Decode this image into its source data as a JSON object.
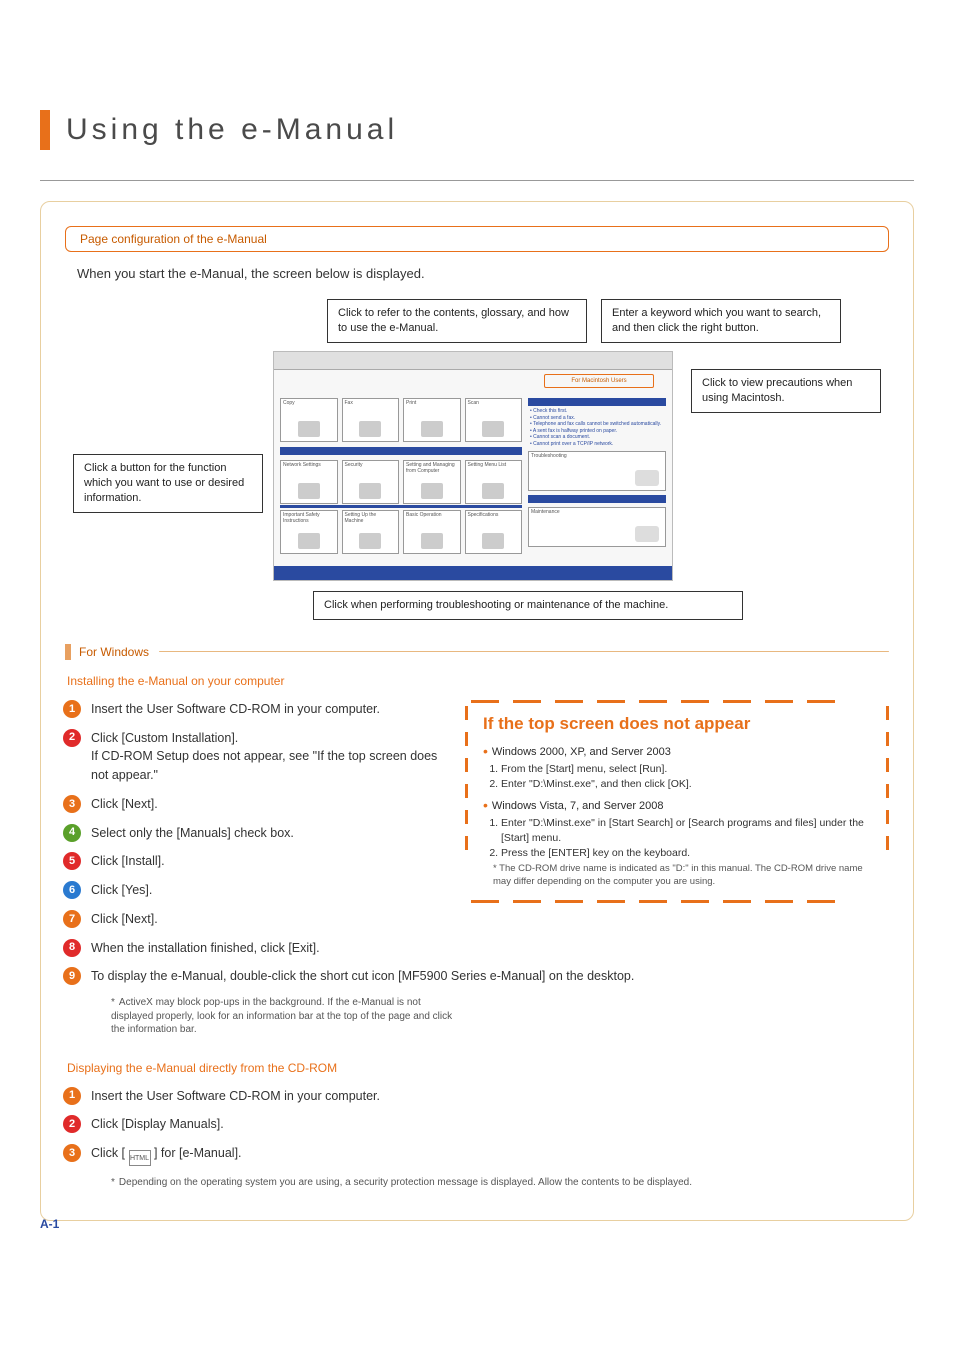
{
  "title": "Using the e-Manual",
  "section1_header": "Page configuration of the e-Manual",
  "intro": "When you start the e-Manual, the screen below is displayed.",
  "callouts": {
    "contents": "Click to refer to the contents, glossary, and how to use the e-Manual.",
    "search": "Enter a keyword which you want to search, and then click the right button.",
    "function": "Click a button for the function which you want to use or desired information.",
    "mac": "Click to view precautions when using Macintosh.",
    "maintenance": "Click when performing troubleshooting or maintenance of the machine."
  },
  "screenshot": {
    "mac_band": "For Macintosh Users",
    "cards_row1": [
      "Copy",
      "Fax",
      "Print",
      "Scan"
    ],
    "cards_row2": [
      "Network Settings",
      "Security",
      "Setting and Managing from Computer",
      "Setting Menu List"
    ],
    "cards_row3": [
      "Important Safety Instructions",
      "Setting Up the Machine",
      "Basic Operation",
      "Specifications"
    ],
    "right_list": [
      "Check this first.",
      "Cannot send a fax.",
      "Telephone and fax calls cannot be switched automatically.",
      "A sent fax is halfway printed on paper.",
      "Cannot scan a document.",
      "Cannot print over a TCP/IP network."
    ],
    "right_box1": "Troubleshooting",
    "right_box2": "Maintenance"
  },
  "for_windows": "For Windows",
  "install_heading": "Installing the e-Manual on your computer",
  "steps_install": [
    "Insert the User Software CD-ROM in your computer.",
    "Click [Custom Installation].",
    "Click [Next].",
    "Select only the [Manuals] check box.",
    "Click [Install].",
    "Click [Yes].",
    "Click [Next].",
    "When the installation finished, click [Exit].",
    "To display the e-Manual, double-click the short cut icon [MF5900 Series e-Manual] on the desktop."
  ],
  "step2_sub": "If CD-ROM Setup does not appear, see \"If the top screen does not appear.\"",
  "activex_note": "ActiveX may block pop-ups in the background. If the e-Manual is not displayed properly, look for an information bar at the top of the page and click the information bar.",
  "dashed": {
    "title": "If the top screen does not appear",
    "winxp": "Windows 2000, XP, and Server 2003",
    "winxp_steps": [
      "From the [Start] menu, select [Run].",
      "Enter \"D:\\Minst.exe\", and then click [OK]."
    ],
    "win7": "Windows Vista, 7, and Server 2008",
    "win7_steps": [
      "Enter \"D:\\Minst.exe\" in [Start Search] or [Search programs and files] under the [Start] menu.",
      "Press the [ENTER] key on the keyboard."
    ],
    "drive_note": "The CD-ROM drive name is indicated as \"D:\" in this manual. The CD-ROM drive name may differ depending on the computer you are using."
  },
  "display_heading": "Displaying the e-Manual directly from the CD-ROM",
  "steps_display": [
    "Insert the User Software CD-ROM in your computer.",
    "Click [Display Manuals].",
    "Click [       ] for [e-Manual]."
  ],
  "display_step3_prefix": "Click [ ",
  "display_step3_suffix": " ] for [e-Manual].",
  "html_icon_label": "HTML",
  "display_note": "Depending on the operating system you are using, a security protection message is displayed. Allow the contents to be displayed.",
  "page_number": "A-1"
}
